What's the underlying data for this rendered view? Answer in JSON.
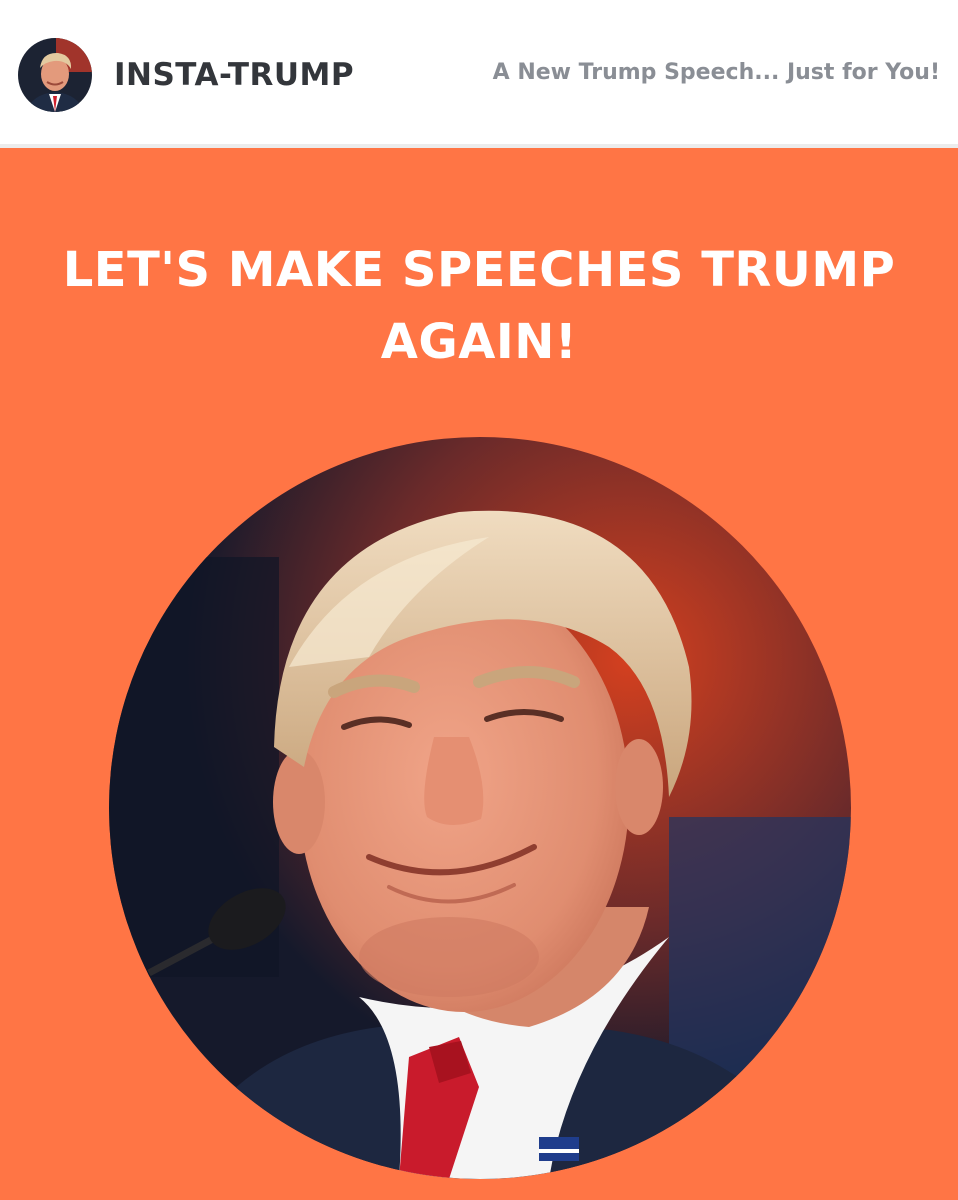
{
  "header": {
    "brand": "INSTA-TRUMP",
    "tagline": "A New Trump Speech... Just for You!"
  },
  "hero": {
    "headline": "LET'S MAKE SPEECHES TRUMP AGAIN!",
    "portrait_alt": "Smiling portrait in a circular frame"
  },
  "colors": {
    "hero_background": "#ff7545",
    "brand_text": "#33363b",
    "tagline_text": "#8a8e95",
    "headline_text": "#ffffff"
  }
}
